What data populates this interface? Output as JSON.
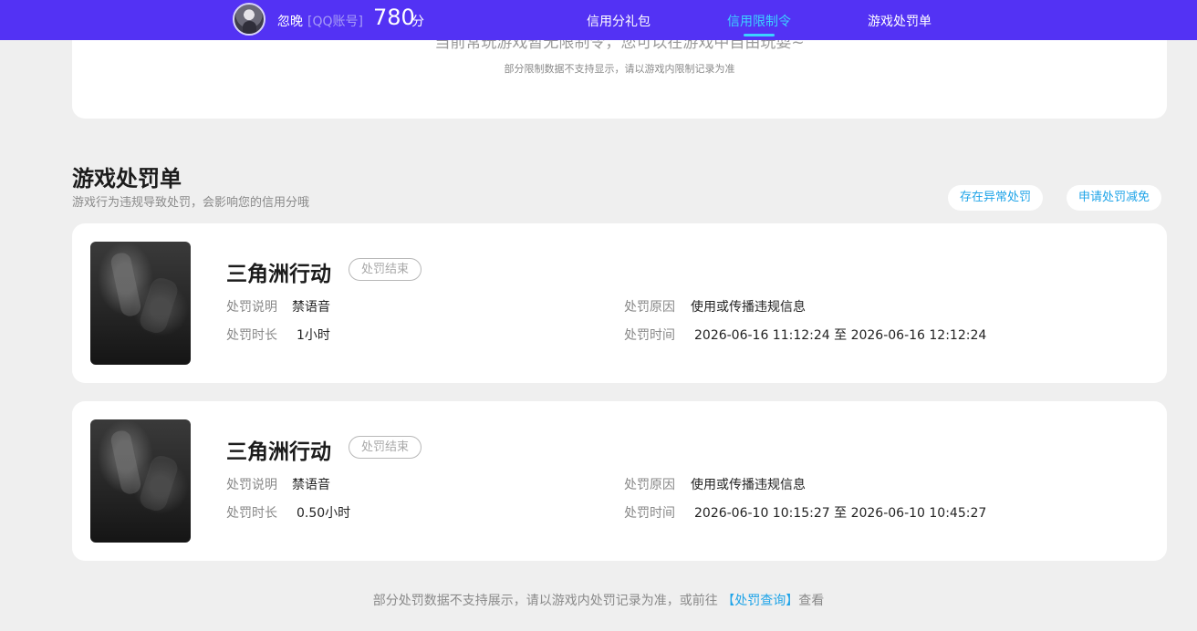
{
  "header": {
    "username": "忽晚",
    "account_type": "[QQ账号]",
    "score": "780",
    "score_unit": "分",
    "nav": [
      {
        "label": "信用分礼包",
        "active": false
      },
      {
        "label": "信用限制令",
        "active": true
      },
      {
        "label": "游戏处罚单",
        "active": false
      }
    ]
  },
  "restriction": {
    "message": "当前常玩游戏暂无限制令，您可以在游戏中自由玩耍~",
    "note": "部分限制数据不支持显示，请以游戏内限制记录为准"
  },
  "penalty_section": {
    "title": "游戏处罚单",
    "subtitle": "游戏行为违规导致处罚，会影响您的信用分哦",
    "buttons": {
      "abnormal": "存在异常处罚",
      "reduce": "申请处罚减免"
    },
    "labels": {
      "desc": "处罚说明",
      "reason": "处罚原因",
      "duration": "处罚时长",
      "time": "处罚时间"
    },
    "cards": [
      {
        "game": "三角洲行动",
        "status": "处罚结束",
        "desc": "禁语音",
        "reason": "使用或传播违规信息",
        "duration": "1小时",
        "time": "2026-06-16 11:12:24 至 2026-06-16 12:12:24"
      },
      {
        "game": "三角洲行动",
        "status": "处罚结束",
        "desc": "禁语音",
        "reason": "使用或传播违规信息",
        "duration": "0.50小时",
        "time": "2026-06-10 10:15:27 至 2026-06-10 10:45:27"
      }
    ]
  },
  "footer": {
    "text_before": "部分处罚数据不支持展示，请以游戏内处罚记录为准，或前往",
    "link": "【处罚查询】",
    "text_after": "查看"
  },
  "colors": {
    "header_bg": "#5332f4",
    "active_nav": "#3cd3ff",
    "link": "#1fa4e8",
    "page_bg": "#efefef"
  }
}
